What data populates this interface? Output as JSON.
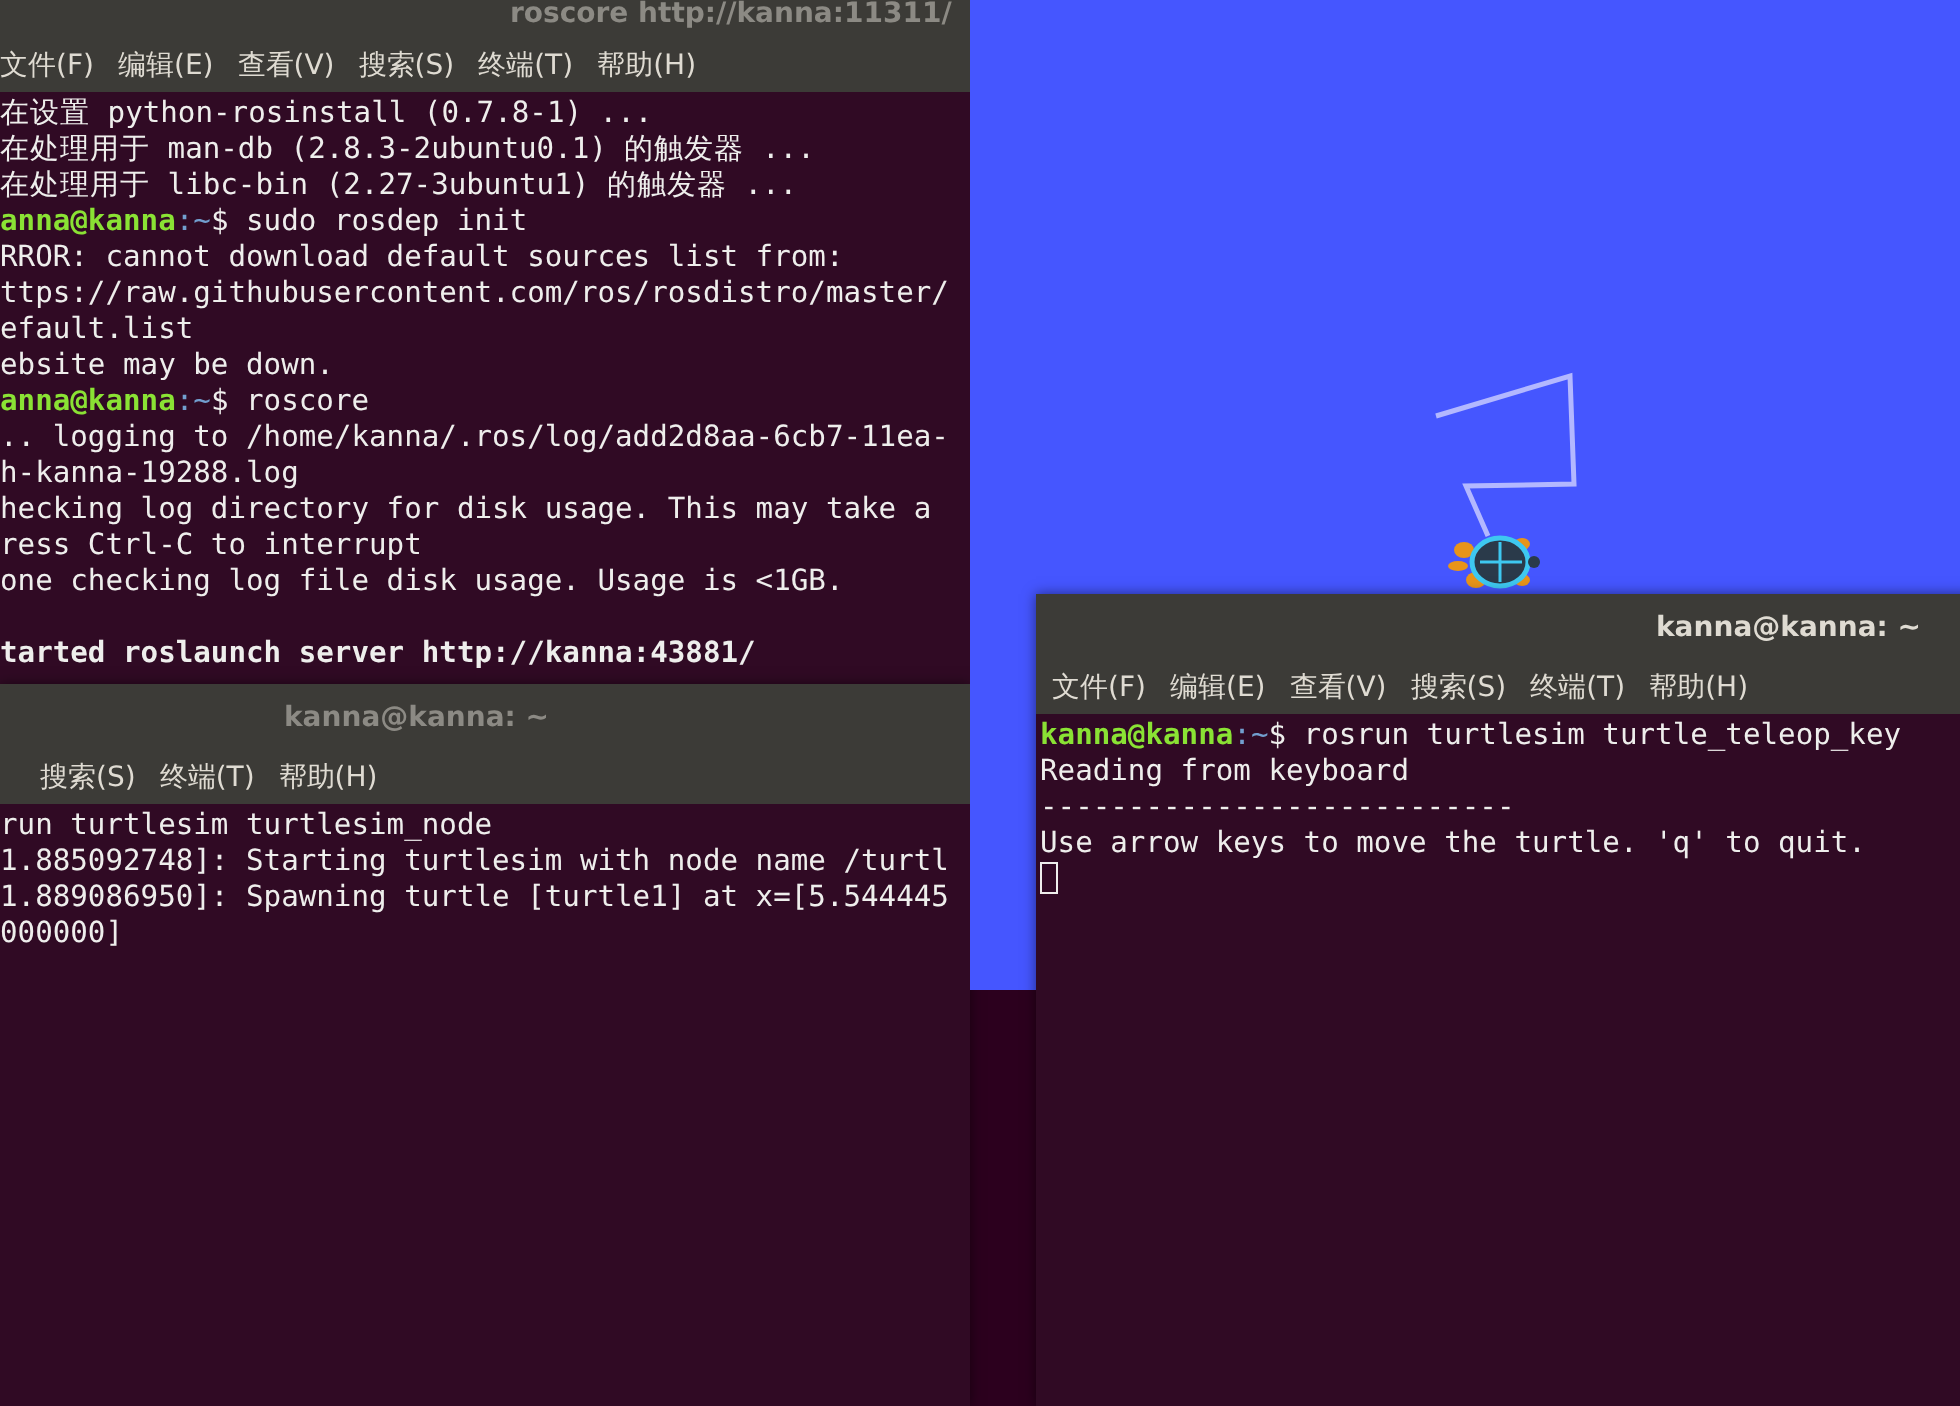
{
  "windows": [
    {
      "title": "roscore http://kanna:11311/",
      "focused": false,
      "menu": [
        "文件(F)",
        "编辑(E)",
        "查看(V)",
        "搜索(S)",
        "终端(T)",
        "帮助(H)"
      ],
      "lines": [
        {
          "kind": "output",
          "text": "在设置 python-rosinstall (0.7.8-1) ..."
        },
        {
          "kind": "output",
          "text": "在处理用于 man-db (2.8.3-2ubuntu0.1) 的触发器 ..."
        },
        {
          "kind": "output",
          "text": "在处理用于 libc-bin (2.27-3ubuntu1) 的触发器 ..."
        },
        {
          "kind": "prompt",
          "user": "anna@kanna",
          "path": ":~",
          "command": "$ sudo rosdep init"
        },
        {
          "kind": "output",
          "text": "RROR: cannot download default sources list from:"
        },
        {
          "kind": "output",
          "text": "ttps://raw.githubusercontent.com/ros/rosdistro/master/"
        },
        {
          "kind": "output",
          "text": "efault.list"
        },
        {
          "kind": "output",
          "text": "ebsite may be down."
        },
        {
          "kind": "prompt",
          "user": "anna@kanna",
          "path": ":~",
          "command": "$ roscore"
        },
        {
          "kind": "output",
          "text": ".. logging to /home/kanna/.ros/log/add2d8aa-6cb7-11ea-"
        },
        {
          "kind": "output",
          "text": "h-kanna-19288.log"
        },
        {
          "kind": "output",
          "text": "hecking log directory for disk usage. This may take a"
        },
        {
          "kind": "output",
          "text": "ress Ctrl-C to interrupt"
        },
        {
          "kind": "output",
          "text": "one checking log file disk usage. Usage is <1GB."
        },
        {
          "kind": "blank"
        },
        {
          "kind": "bold",
          "text": "tarted roslaunch server http://kanna:43881/"
        }
      ]
    },
    {
      "title": "kanna@kanna: ~",
      "focused": false,
      "menu": [
        "搜索(S)",
        "终端(T)",
        "帮助(H)"
      ],
      "lines": [
        {
          "kind": "output",
          "text": "run turtlesim turtlesim_node"
        },
        {
          "kind": "output",
          "text": "1.885092748]: Starting turtlesim with node name /turtl"
        },
        {
          "kind": "output",
          "text": "1.889086950]: Spawning turtle [turtle1] at x=[5.544445"
        },
        {
          "kind": "output",
          "text": "000000]"
        }
      ]
    },
    {
      "title": "kanna@kanna: ~",
      "focused": true,
      "cursor": true,
      "menu": [
        "文件(F)",
        "编辑(E)",
        "查看(V)",
        "搜索(S)",
        "终端(T)",
        "帮助(H)"
      ],
      "lines": [
        {
          "kind": "prompt",
          "user": "kanna@kanna",
          "path": ":~",
          "command": "$ rosrun turtlesim turtle_teleop_key"
        },
        {
          "kind": "output",
          "text": "Reading from keyboard"
        },
        {
          "kind": "output",
          "text": "---------------------------"
        },
        {
          "kind": "output",
          "text": "Use arrow keys to move the turtle. 'q' to quit."
        }
      ]
    }
  ]
}
